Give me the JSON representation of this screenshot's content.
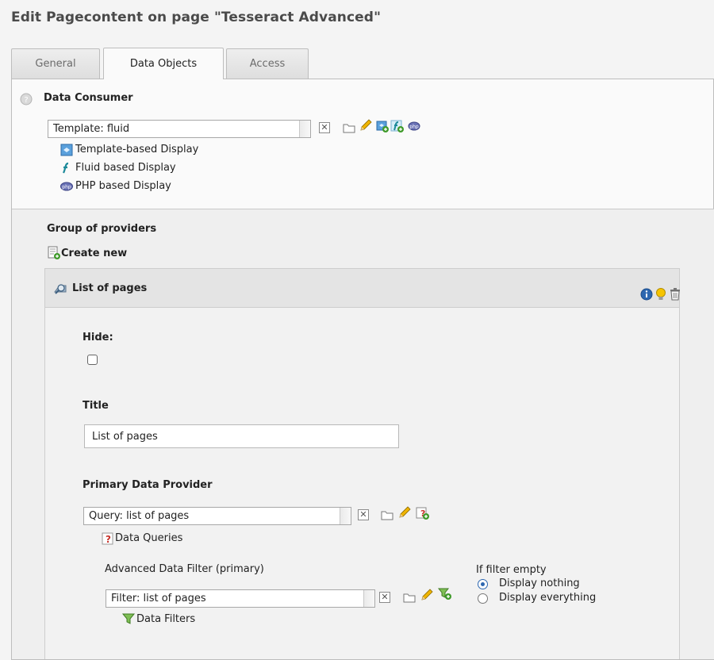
{
  "page_title": "Edit Pagecontent on page \"Tesseract Advanced\"",
  "tabs": [
    {
      "label": "General",
      "active": false
    },
    {
      "label": "Data Objects",
      "active": true
    },
    {
      "label": "Access",
      "active": false
    }
  ],
  "consumer": {
    "heading": "Data Consumer",
    "select_value": "Template: fluid",
    "clear_glyph": "✕",
    "types": [
      {
        "label": "Template-based Display",
        "icon": "template-display-icon"
      },
      {
        "label": "Fluid based Display",
        "icon": "fluid-display-icon"
      },
      {
        "label": "PHP based Display",
        "icon": "php-display-icon"
      }
    ]
  },
  "providers_group": {
    "heading": "Group of providers",
    "create_label": "Create new",
    "record": {
      "title": "List of pages",
      "hide_label": "Hide:",
      "hide_checked": false,
      "title_label": "Title",
      "title_value": "List of pages",
      "primary_label": "Primary Data Provider",
      "primary_value": "Query: list of pages",
      "primary_types": [
        {
          "label": "Data Queries",
          "icon": "data-query-icon"
        }
      ],
      "filter_label": "Advanced Data Filter (primary)",
      "filter_value": "Filter: list of pages",
      "filter_types": [
        {
          "label": "Data Filters",
          "icon": "data-filter-icon"
        }
      ],
      "if_empty_label": "If filter empty",
      "if_empty_options": [
        {
          "label": "Display nothing",
          "selected": true
        },
        {
          "label": "Display everything",
          "selected": false
        }
      ]
    }
  },
  "colors": {
    "accent_blue": "#2d67b0",
    "pencil_yellow": "#f0b400",
    "add_green": "#3f9a2a",
    "delete_red": "#c8332b"
  }
}
